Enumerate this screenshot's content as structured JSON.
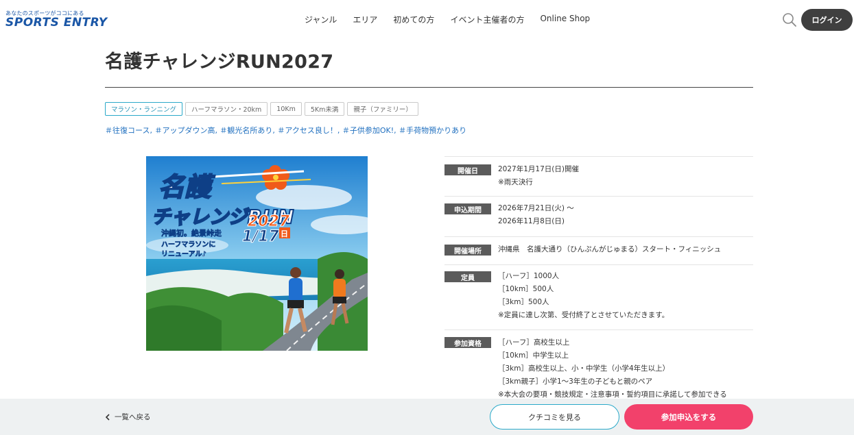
{
  "header": {
    "logo_tagline": "あなたのスポーツがココにある",
    "logo_brand": "SPORTS ENTRY",
    "nav": [
      "ジャンル",
      "エリア",
      "初めての方",
      "イベント主催者の方",
      "Online Shop"
    ],
    "login_label": "ログイン",
    "search_icon": "search-icon"
  },
  "event": {
    "title": "名護チャレンジRUN2027",
    "tags": [
      "マラソン・ランニング",
      "ハーフマラソン・20km",
      "10Km",
      "5Km未満",
      "親子（ファミリー）"
    ],
    "hashtags": "＃往復コース, ＃アップダウン高, ＃観光名所あり, ＃アクセス良し！, ＃子供参加OK!, ＃手荷物預かりあり"
  },
  "poster": {
    "line1": "名護",
    "line2": "チャレンジRUN",
    "year": "2027",
    "date": "1/17",
    "weekday": "日",
    "sub1": "沖縄初。絶景峠走",
    "sub2": "ハーフマラソンに",
    "sub3": "リニューアル♪"
  },
  "info": {
    "rows": [
      {
        "label": "開催日",
        "lines": [
          "2027年1月17日(日)開催",
          "※雨天決行"
        ]
      },
      {
        "label": "申込期間",
        "lines": [
          "2026年7月21日(火) 〜",
          "2026年11月8日(日)"
        ]
      },
      {
        "label": "開催場所",
        "lines": [
          "沖縄県　名護大通り（ひんぷんがじゅまる）スタート・フィニッシュ"
        ]
      },
      {
        "label": "定員",
        "lines": [
          "［ハーフ］1000人",
          "［10km］500人",
          "［3km］500人",
          "※定員に達し次第、受付終了とさせていただきます。"
        ]
      },
      {
        "label": "参加資格",
        "lines": [
          "［ハーフ］高校生以上",
          "［10km］中学生以上",
          "［3km］高校生以上、小・中学生（小学4年生以上）",
          "［3km親子］小学1〜3年生の子どもと親のペア",
          "※本大会の要項・競技規定・注意事項・誓約項目に承諾して参加できる"
        ]
      }
    ]
  },
  "bottom": {
    "back_label": "一覧へ戻る",
    "review_label": "クチコミを見る",
    "apply_label": "参加申込をする"
  },
  "colors": {
    "brand_blue": "#1a56a6",
    "accent_cyan": "#2aa9c9",
    "apply_pink": "#f2416b",
    "label_gray": "#5b5b5b"
  }
}
